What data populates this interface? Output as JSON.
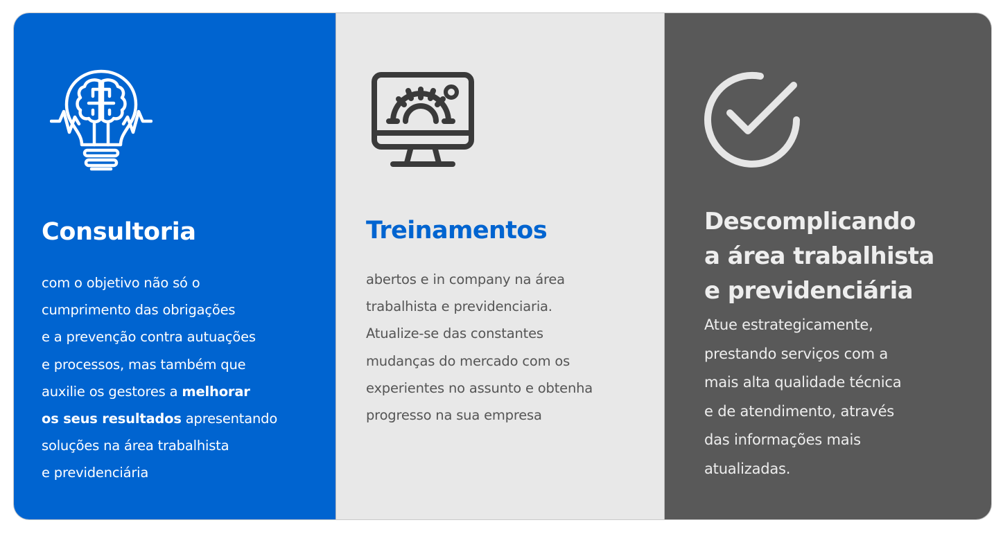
{
  "cards": [
    {
      "icon": "lightbulb-brain-icon",
      "title": "Consultoria",
      "lines": [
        [
          {
            "text": "com o objetivo não só o"
          }
        ],
        [
          {
            "text": "cumprimento das obrigações"
          }
        ],
        [
          {
            "text": "e a prevenção contra autuações"
          }
        ],
        [
          {
            "text": "e processos, mas também que"
          }
        ],
        [
          {
            "text": "auxilie os gestores a "
          },
          {
            "text": "melhorar",
            "bold": true
          }
        ],
        [
          {
            "text": "os seus resultados",
            "bold": true
          },
          {
            "text": " apresentando"
          }
        ],
        [
          {
            "text": "soluções na área trabalhista"
          }
        ],
        [
          {
            "text": "e previdenciária"
          }
        ]
      ]
    },
    {
      "icon": "monitor-gear-icon",
      "title": "Treinamentos",
      "lines": [
        [
          {
            "text": "abertos e in company na área"
          }
        ],
        [
          {
            "text": "trabalhista e previdenciaria."
          }
        ],
        [
          {
            "text": "Atualize-se das constantes"
          }
        ],
        [
          {
            "text": "mudanças do mercado com os"
          }
        ],
        [
          {
            "text": "experientes no assunto e obtenha"
          }
        ],
        [
          {
            "text": "progresso na sua empresa"
          }
        ]
      ]
    },
    {
      "icon": "circle-check-icon",
      "title_lines": [
        "Descomplicando",
        "a área trabalhista",
        "e previdenciária"
      ],
      "lines": [
        [
          {
            "text": "Atue estrategicamente,"
          }
        ],
        [
          {
            "text": "prestando serviços com a"
          }
        ],
        [
          {
            "text": "mais alta qualidade técnica"
          }
        ],
        [
          {
            "text": "e de atendimento, através"
          }
        ],
        [
          {
            "text": "das informações mais"
          }
        ],
        [
          {
            "text": "atualizadas."
          }
        ]
      ]
    }
  ],
  "colors": {
    "blue": "#0064d0",
    "light_gray": "#e8e8e8",
    "dark_gray": "#595959",
    "icon_dark": "#3a3a3a",
    "icon_light": "#e6e6e6"
  }
}
